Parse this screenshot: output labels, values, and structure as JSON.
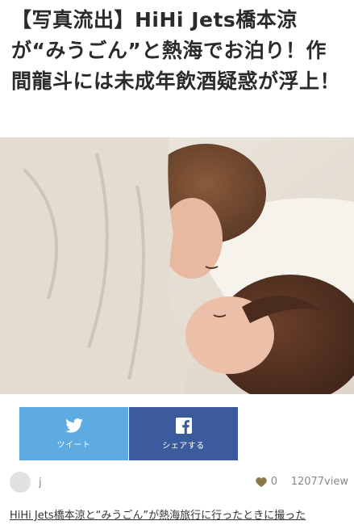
{
  "article": {
    "title": "【写真流出】HiHi Jets橋本涼が“みうごん”と熱海でお泊り！作間龍斗には未成年飲酒疑惑が浮上！",
    "body_excerpt": "HiHi Jets橋本涼と“みうごん”が熱海旅行に行ったときに撮った"
  },
  "share": {
    "twitter_label": "ツイート",
    "facebook_label": "シェアする",
    "twitter_color": "#5eaae2",
    "facebook_color": "#3b5b9c"
  },
  "meta": {
    "author": "j",
    "likes": "0",
    "views": "12077view"
  },
  "icons": [
    "twitter-bird-icon",
    "facebook-f-icon",
    "heart-icon"
  ]
}
